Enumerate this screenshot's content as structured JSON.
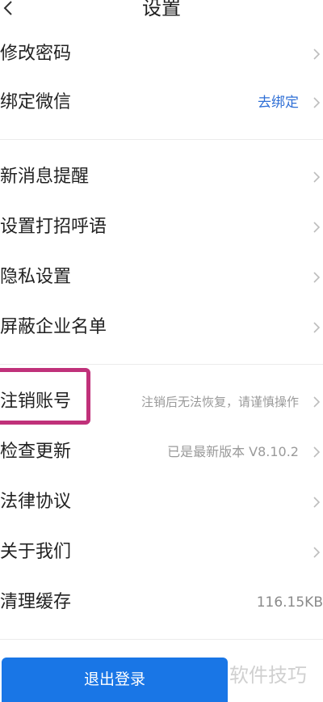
{
  "header": {
    "title": "设置",
    "back_icon": "chevron-left-icon"
  },
  "section1": {
    "items": [
      {
        "label": "修改密码",
        "value": ""
      },
      {
        "label": "绑定微信",
        "value": "去绑定"
      }
    ]
  },
  "section2": {
    "items": [
      {
        "label": "新消息提醒",
        "value": ""
      },
      {
        "label": "设置打招呼语",
        "value": ""
      },
      {
        "label": "隐私设置",
        "value": ""
      },
      {
        "label": "屏蔽企业名单",
        "value": ""
      }
    ]
  },
  "section3": {
    "items": [
      {
        "label": "注销账号",
        "value": "注销后无法恢复，请谨慎操作"
      },
      {
        "label": "检查更新",
        "value": "已是最新版本 V8.10.2"
      },
      {
        "label": "法律协议",
        "value": ""
      },
      {
        "label": "关于我们",
        "value": ""
      },
      {
        "label": "清理缓存",
        "value": "116.15KB"
      }
    ]
  },
  "footer": {
    "logout_label": "退出登录",
    "watermark": "软件技巧"
  },
  "colors": {
    "accent": "#2f6fd6",
    "button": "#1976e6",
    "highlight": "#c0317a"
  }
}
